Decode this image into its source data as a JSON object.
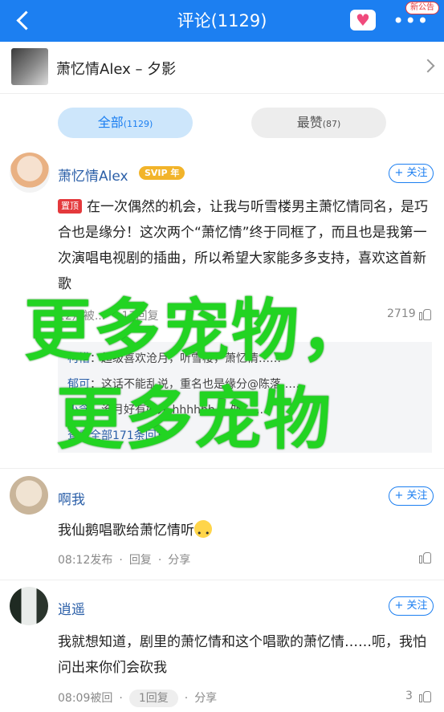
{
  "header": {
    "title": "评论(1129)",
    "notice_badge": "新公告",
    "more_label": "•••",
    "accent": "#1c7ff1"
  },
  "song": {
    "title": "萧忆情Alex – 夕影"
  },
  "tabs": {
    "all_label": "全部",
    "all_count": "(1129)",
    "hot_label": "最赞",
    "hot_count": "(87)"
  },
  "comments": [
    {
      "user": "萧忆情Alex",
      "badge": "SVIP 年",
      "follow": "+ 关注",
      "pin": "置顶",
      "text": "在一次偶然的机会，让我与听雪楼男主萧忆情同名，是巧合也是缘分！这次两个“萧忆情”终于同框了，而且也是我第一次演唱电视剧的插曲，所以希望大家能多多支持，喜欢这首新歌",
      "time": "12月被...",
      "reply": "17回复",
      "share": "分享",
      "likes": "2719",
      "replies": [
        {
          "user": "柯惜",
          "text": "：超级喜欢沧月，听雪楼，萧忆情……"
        },
        {
          "user": "郁可",
          "text": "：这话不能乱说，重名也是缘分@陈落……"
        },
        {
          "user": "小念",
          "text": "：沧月好有好人 hhhhhh… 处……"
        }
      ],
      "more_replies": "查看全部171条回复"
    },
    {
      "user": "啊我",
      "follow": "+ 关注",
      "text": "我仙鹅唱歌给萧忆情听",
      "time": "08:12发布",
      "reply": "回复",
      "share": "分享",
      "likes": ""
    },
    {
      "user": "逍遥",
      "follow": "+ 关注",
      "text": "我就想知道，剧里的萧忆情和这个唱歌的萧忆情……呃，我怕问出来你们会砍我",
      "time": "08:09被回",
      "reply": "1回复",
      "share": "分享",
      "likes": "3"
    }
  ],
  "overlay": {
    "line1": "更多宠物，",
    "line2": "更多宠物"
  }
}
